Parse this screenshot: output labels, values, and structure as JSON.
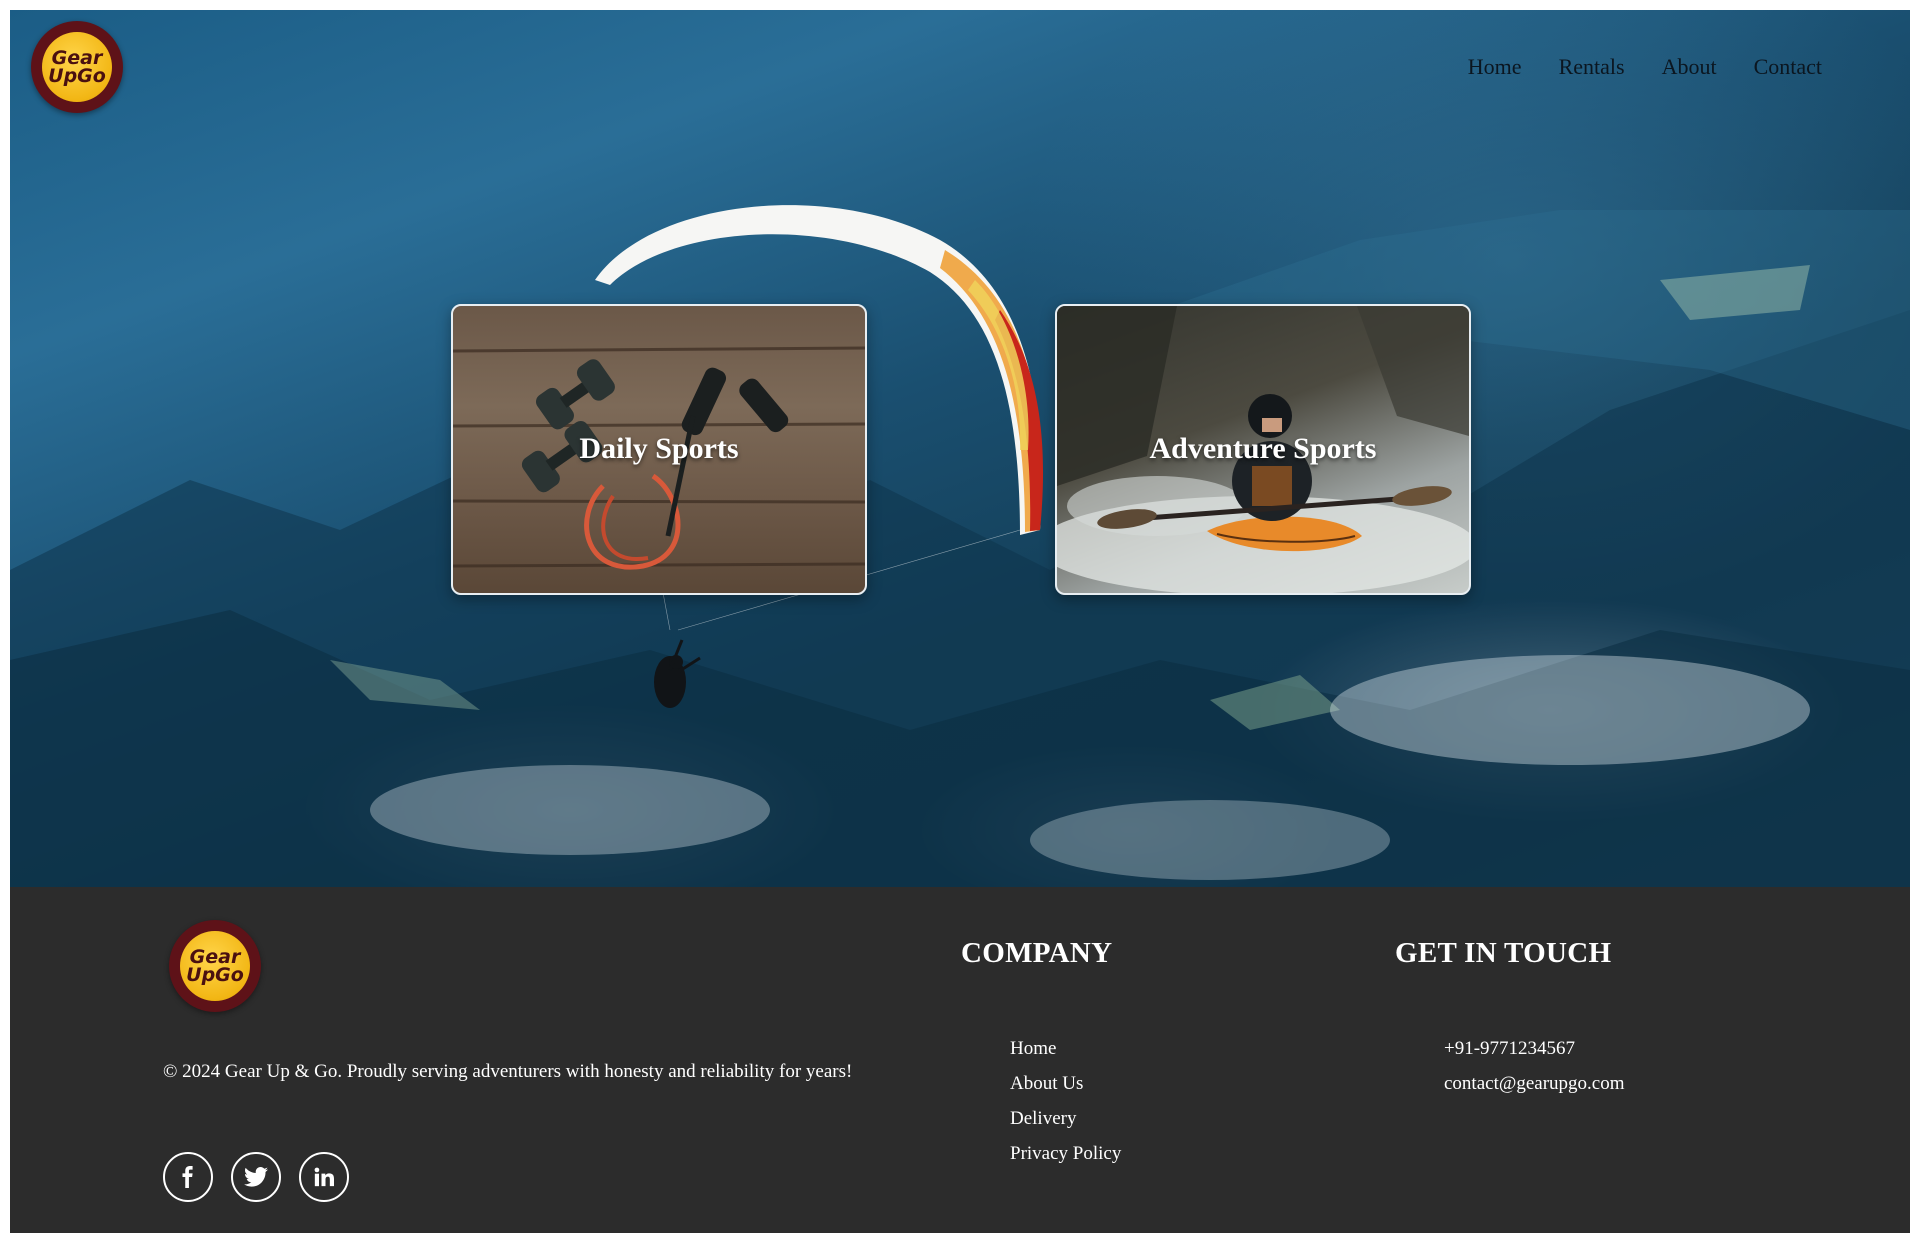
{
  "brand": {
    "logo_line1": "Gear",
    "logo_line2": "UpGo"
  },
  "nav": {
    "items": [
      "Home",
      "Rentals",
      "About",
      "Contact"
    ]
  },
  "cards": [
    {
      "title": "Daily Sports"
    },
    {
      "title": "Adventure Sports"
    }
  ],
  "footer": {
    "copyright": "© 2024 Gear Up & Go. Proudly serving adventurers with honesty and reliability for years!",
    "socials": [
      "facebook-icon",
      "twitter-icon",
      "linkedin-icon"
    ],
    "company": {
      "title": "COMPANY",
      "links": [
        "Home",
        "About Us",
        "Delivery",
        "Privacy Policy"
      ]
    },
    "contact": {
      "title": "GET IN TOUCH",
      "phone": "+91-9771234567",
      "email": "contact@gearupgo.com"
    }
  },
  "colors": {
    "footer_bg": "#2c2c2c",
    "logo_ring": "#5e1218",
    "logo_fill": "#f2b614"
  }
}
